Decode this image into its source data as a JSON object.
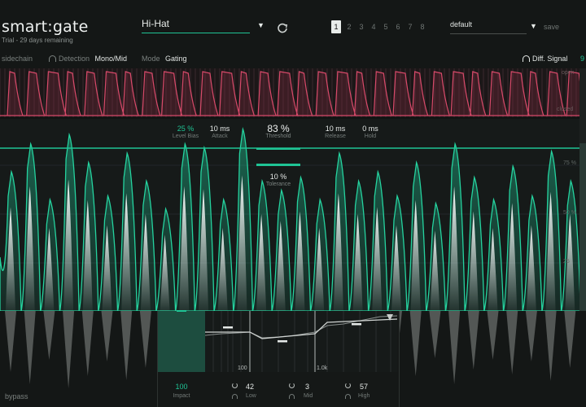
{
  "header": {
    "logo": "smart:gate",
    "trial_text": "Trial - 29 days remaining",
    "preset_value": "Hi-Hat",
    "slots": [
      "1",
      "2",
      "3",
      "4",
      "5",
      "6",
      "7",
      "8"
    ],
    "active_slot": "1",
    "settings_value": "default",
    "save_label": "save"
  },
  "subbar": {
    "sidechain_label": "sidechain",
    "detection_label": "Detection",
    "detection_value": "Mono/Mid",
    "mode_label": "Mode",
    "mode_value": "Gating",
    "diff_signal_label": "Diff. Signal",
    "right_value": "9"
  },
  "gr_strip": {
    "open_label": "open",
    "closed_label": "closed"
  },
  "scale": {
    "p75": "75 %",
    "p50": "50 %",
    "p25": "25"
  },
  "params": {
    "level_bias_value": "25 %",
    "level_bias_label": "Level Bias",
    "attack_value": "10 ms",
    "attack_label": "Attack",
    "threshold_value": "83 %",
    "threshold_label": "Threshold",
    "release_value": "10 ms",
    "release_label": "Release",
    "hold_value": "0 ms",
    "hold_label": "Hold",
    "tolerance_value": "10 %",
    "tolerance_label": "Tolerance"
  },
  "bottom": {
    "impact_value": "100",
    "impact_label": "Impact",
    "low_value": "42",
    "low_label": "Low",
    "mid_value": "3",
    "mid_label": "Mid",
    "high_value": "57",
    "high_label": "High",
    "freq_low": "100",
    "freq_high": "1.0k",
    "bypass_label": "bypass"
  },
  "colors": {
    "accent": "#1fc495",
    "gate_red": "#d84a6a",
    "background": "#111413"
  }
}
